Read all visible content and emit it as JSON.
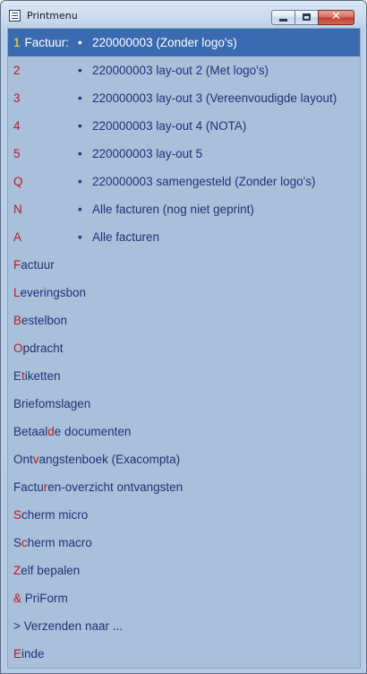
{
  "window": {
    "title": "Printmenu",
    "close_glyph": "✕",
    "icon": "window-list-icon"
  },
  "numbered_items": [
    {
      "key": "1",
      "label": "Factuur:",
      "bullet": "•",
      "desc": "220000003 (Zonder logo's)"
    },
    {
      "key": "2",
      "bullet": "•",
      "desc": "220000003 lay-out 2 (Met logo's)"
    },
    {
      "key": "3",
      "bullet": "•",
      "desc": "220000003 lay-out 3 (Vereenvoudigde layout)"
    },
    {
      "key": "4",
      "bullet": "•",
      "desc": "220000003 lay-out 4 (NOTA)"
    },
    {
      "key": "5",
      "bullet": "•",
      "desc": "220000003 lay-out 5"
    },
    {
      "key": "Q",
      "bullet": "•",
      "desc": "220000003 samengesteld (Zonder logo's)"
    },
    {
      "key": "N",
      "bullet": "•",
      "desc": "Alle facturen (nog niet geprint)"
    },
    {
      "key": "A",
      "bullet": "•",
      "desc": "Alle facturen"
    }
  ],
  "menu_items": [
    {
      "before": "",
      "hotkey": "F",
      "after": "actuur"
    },
    {
      "before": "",
      "hotkey": "L",
      "after": "everingsbon"
    },
    {
      "before": "",
      "hotkey": "B",
      "after": "estelbon"
    },
    {
      "before": "",
      "hotkey": "O",
      "after": "pdracht"
    },
    {
      "before": "E",
      "hotkey": "t",
      "after": "iketten"
    },
    {
      "before": "Briefomslagen",
      "hotkey": "",
      "after": ""
    },
    {
      "before": "Betaal",
      "hotkey": "d",
      "after": "e documenten"
    },
    {
      "before": "Ont",
      "hotkey": "v",
      "after": "angstenboek (Exacompta)"
    },
    {
      "before": "Factu",
      "hotkey": "r",
      "after": "en-overzicht ontvangsten"
    },
    {
      "before": "",
      "hotkey": "S",
      "after": "cherm micro"
    },
    {
      "before": "S",
      "hotkey": "c",
      "after": "herm macro"
    },
    {
      "before": "",
      "hotkey": "Z",
      "after": "elf bepalen"
    },
    {
      "before": "",
      "hotkey": "&",
      "after": " PriForm"
    },
    {
      "before": "> Verzenden naar ...",
      "hotkey": "",
      "after": ""
    },
    {
      "before": "",
      "hotkey": "E",
      "after": "inde"
    }
  ],
  "colors": {
    "hotkey": "#c01818",
    "selected_hotkey": "#ffe047",
    "text": "#1e3378",
    "selection": "#3a6ab0",
    "client_bg": "#a9c0db"
  }
}
